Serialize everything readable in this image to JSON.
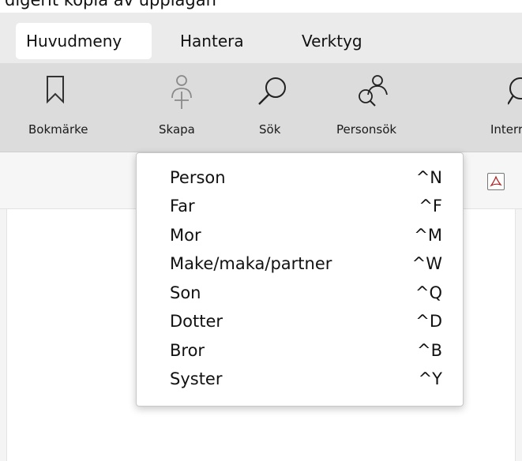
{
  "top_text": "digerit kopia av upplagan",
  "tabs": [
    {
      "label": "Huvudmeny",
      "active": true
    },
    {
      "label": "Hantera",
      "active": false
    },
    {
      "label": "Verktyg",
      "active": false
    }
  ],
  "toolbar": {
    "items": [
      {
        "label": "Bokmärke",
        "icon": "bookmark-icon"
      },
      {
        "label": "Skapa",
        "icon": "add-person-icon"
      },
      {
        "label": "Sök",
        "icon": "search-icon"
      },
      {
        "label": "Personsök",
        "icon": "person-search-icon"
      },
      {
        "label": "Interr",
        "icon": "internet-icon"
      }
    ]
  },
  "create_menu": {
    "items": [
      {
        "label": "Person",
        "shortcut": "^N"
      },
      {
        "label": "Far",
        "shortcut": "^F"
      },
      {
        "label": "Mor",
        "shortcut": "^M"
      },
      {
        "label": "Make/maka/partner",
        "shortcut": "^W"
      },
      {
        "label": "Son",
        "shortcut": "^Q"
      },
      {
        "label": "Dotter",
        "shortcut": "^D"
      },
      {
        "label": "Bror",
        "shortcut": "^B"
      },
      {
        "label": "Syster",
        "shortcut": "^Y"
      }
    ]
  },
  "colors": {
    "tabbar_bg": "#ebebeb",
    "toolbar_bg": "#dcdcdc",
    "menu_bg": "#ffffff"
  }
}
